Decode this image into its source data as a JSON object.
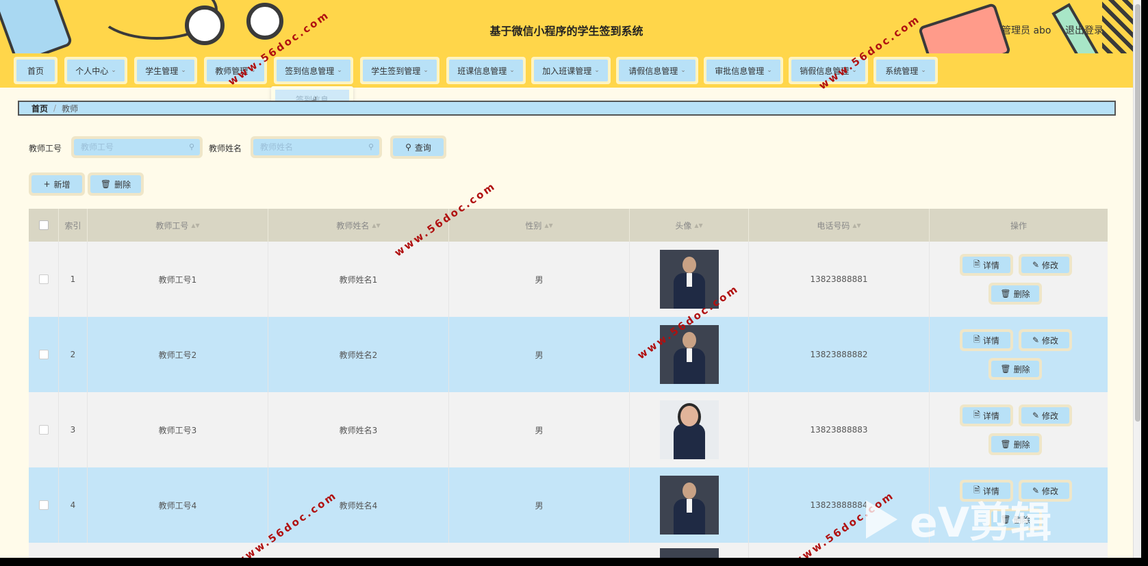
{
  "header": {
    "title": "基于微信小程序的学生签到系统",
    "user": "管理员 abo",
    "logout": "退出登录"
  },
  "nav": {
    "items": [
      {
        "label": "首页"
      },
      {
        "label": "个人中心"
      },
      {
        "label": "学生管理"
      },
      {
        "label": "教师管理"
      },
      {
        "label": "签到信息管理"
      },
      {
        "label": "学生签到管理"
      },
      {
        "label": "班课信息管理"
      },
      {
        "label": "加入班课管理"
      },
      {
        "label": "请假信息管理"
      },
      {
        "label": "审批信息管理"
      },
      {
        "label": "销假信息管理"
      },
      {
        "label": "系统管理"
      }
    ],
    "submenu_item": "签到信息"
  },
  "breadcrumb": {
    "home": "首页",
    "sep": "/",
    "current": "教师"
  },
  "search": {
    "teacher_no_label": "教师工号",
    "teacher_no_placeholder": "教师工号",
    "teacher_name_label": "教师姓名",
    "teacher_name_placeholder": "教师姓名",
    "query_label": "查询"
  },
  "actions": {
    "add": "新增",
    "delete": "删除"
  },
  "table": {
    "headers": {
      "index": "索引",
      "teacher_no": "教师工号",
      "teacher_name": "教师姓名",
      "gender": "性别",
      "avatar": "头像",
      "phone": "电话号码",
      "ops": "操作"
    },
    "rows": [
      {
        "index": "1",
        "teacher_no": "教师工号1",
        "teacher_name": "教师姓名1",
        "gender": "男",
        "phone": "13823888881"
      },
      {
        "index": "2",
        "teacher_no": "教师工号2",
        "teacher_name": "教师姓名2",
        "gender": "男",
        "phone": "13823888882"
      },
      {
        "index": "3",
        "teacher_no": "教师工号3",
        "teacher_name": "教师姓名3",
        "gender": "男",
        "phone": "13823888883"
      },
      {
        "index": "4",
        "teacher_no": "教师工号4",
        "teacher_name": "教师姓名4",
        "gender": "男",
        "phone": "13823888884"
      }
    ],
    "row_ops": {
      "detail": "详情",
      "edit": "修改",
      "delete": "删除"
    }
  },
  "watermark": "www.56doc.com",
  "overlay_logo": "eV剪辑",
  "icons": {
    "search": "search-icon",
    "plus": "plus-icon",
    "trash": "trash-icon",
    "detail": "document-icon",
    "edit": "pencil-icon",
    "caret": "chevron-down-icon",
    "sort": "sort-icon",
    "cursor": "hand-cursor-icon"
  },
  "colors": {
    "header_bg": "#ffd64a",
    "button_bg": "#b8e1f7",
    "page_bg": "#fffbea",
    "row_alt": "#c4e5f8"
  }
}
